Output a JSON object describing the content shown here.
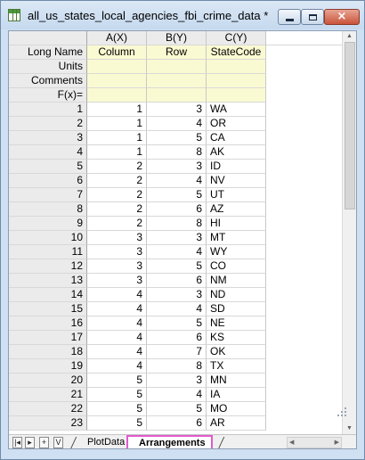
{
  "window": {
    "title": "all_us_states_local_agencies_fbi_crime_data *",
    "icons": {
      "app": "worksheet-icon",
      "minimize": "minimize-icon",
      "maximize": "maximize-icon",
      "close": "close-icon"
    },
    "close_glyph": "×"
  },
  "columns": [
    {
      "header": "A(X)",
      "long_name": "Column",
      "units": "",
      "comments": "",
      "fx": ""
    },
    {
      "header": "B(Y)",
      "long_name": "Row",
      "units": "",
      "comments": "",
      "fx": ""
    },
    {
      "header": "C(Y)",
      "long_name": "StateCode",
      "units": "",
      "comments": "",
      "fx": ""
    }
  ],
  "label_rows": [
    "Long Name",
    "Units",
    "Comments",
    "F(x)="
  ],
  "rows": [
    [
      "1",
      "1",
      "3",
      "WA"
    ],
    [
      "2",
      "1",
      "4",
      "OR"
    ],
    [
      "3",
      "1",
      "5",
      "CA"
    ],
    [
      "4",
      "1",
      "8",
      "AK"
    ],
    [
      "5",
      "2",
      "3",
      "ID"
    ],
    [
      "6",
      "2",
      "4",
      "NV"
    ],
    [
      "7",
      "2",
      "5",
      "UT"
    ],
    [
      "8",
      "2",
      "6",
      "AZ"
    ],
    [
      "9",
      "2",
      "8",
      "HI"
    ],
    [
      "10",
      "3",
      "3",
      "MT"
    ],
    [
      "11",
      "3",
      "4",
      "WY"
    ],
    [
      "12",
      "3",
      "5",
      "CO"
    ],
    [
      "13",
      "3",
      "6",
      "NM"
    ],
    [
      "14",
      "4",
      "3",
      "ND"
    ],
    [
      "15",
      "4",
      "4",
      "SD"
    ],
    [
      "16",
      "4",
      "5",
      "NE"
    ],
    [
      "17",
      "4",
      "6",
      "KS"
    ],
    [
      "18",
      "4",
      "7",
      "OK"
    ],
    [
      "19",
      "4",
      "8",
      "TX"
    ],
    [
      "20",
      "5",
      "3",
      "MN"
    ],
    [
      "21",
      "5",
      "4",
      "IA"
    ],
    [
      "22",
      "5",
      "5",
      "MO"
    ],
    [
      "23",
      "5",
      "6",
      "AR"
    ]
  ],
  "sheet_nav": {
    "first": "|◂",
    "prev": "▸",
    "add": "+",
    "view": "V"
  },
  "sheet_tabs": [
    {
      "label": "PlotData",
      "active": false
    },
    {
      "label": "Arrangements",
      "active": true
    }
  ],
  "colors": {
    "label_row_bg": "#fafad2",
    "header_bg": "#ebebeb",
    "active_tab_border": "#e05ad0",
    "close_button": "#c9543a"
  }
}
